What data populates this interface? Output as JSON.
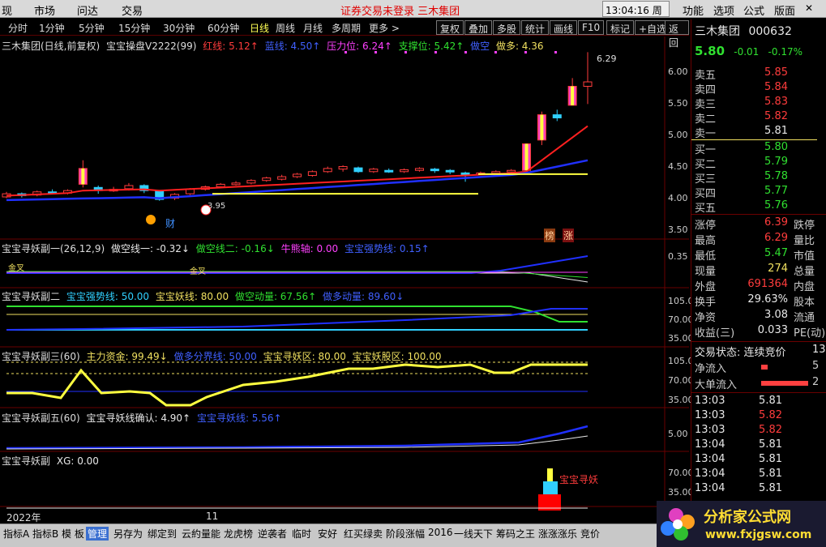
{
  "menu": {
    "left": [
      "现",
      "市场",
      "问达",
      "交易"
    ],
    "notice": "证券交易未登录  三木集团",
    "clock": "13:04:16 周三",
    "right": [
      "功能",
      "选项",
      "公式",
      "版面"
    ]
  },
  "periods": [
    "分时",
    "1分钟",
    "5分钟",
    "15分钟",
    "30分钟",
    "60分钟",
    "日线",
    "周线",
    "月线",
    "多周期",
    "更多 >"
  ],
  "active_period": "日线",
  "toolbar": [
    "复权",
    "叠加",
    "多股",
    "统计",
    "画线",
    "F10",
    "标记",
    "+自选",
    "返回"
  ],
  "main_panel": {
    "title": "三木集团(日线,前复权)",
    "indicator": "宝宝操盘V2222(99)",
    "labels": [
      {
        "text": "红线: 5.12↑",
        "color": "#ff3c3c"
      },
      {
        "text": "蓝线: 4.50↑",
        "color": "#4060ff"
      },
      {
        "text": "压力位: 6.24↑",
        "color": "#ff40ff"
      },
      {
        "text": "支撑位: 5.42↑",
        "color": "#30e030"
      },
      {
        "text": "做空",
        "color": "#4060ff"
      },
      {
        "text": "做多: 4.36",
        "color": "#f0e060"
      }
    ],
    "yticks": [
      "6.00",
      "5.50",
      "5.00",
      "4.50",
      "4.00",
      "3.50"
    ],
    "peak_label": "6.29",
    "low_label": "3.95",
    "marker_cai": "财",
    "marker_bang": "榜",
    "marker_zhang": "涨"
  },
  "sub1": {
    "name": "宝宝寻妖副一(26,12,9)",
    "labels": [
      {
        "text": "做空线一: -0.32↓",
        "color": "#e8e8e8"
      },
      {
        "text": "做空线二: -0.16↓",
        "color": "#30e030"
      },
      {
        "text": "牛熊轴: 0.00",
        "color": "#ff40ff"
      },
      {
        "text": "宝宝强势线: 0.15↑",
        "color": "#4060ff"
      }
    ],
    "ytick": "0.35",
    "tag1": "金叉",
    "tag2": "金叉"
  },
  "sub2": {
    "name": "宝宝寻妖副二",
    "labels": [
      {
        "text": "宝宝强势线: 50.00",
        "color": "#30d0ff"
      },
      {
        "text": "宝宝妖线: 80.00",
        "color": "#f0e060"
      },
      {
        "text": "做空动量: 67.56↑",
        "color": "#30e030"
      },
      {
        "text": "做多动量: 89.60↓",
        "color": "#4060ff"
      }
    ],
    "yticks": [
      "105.0",
      "70.00",
      "35.00"
    ]
  },
  "sub3": {
    "name": "宝宝寻妖副三(60)",
    "labels": [
      {
        "text": "主力资金: 99.49↓",
        "color": "#f0e060"
      },
      {
        "text": "做多分界线: 50.00",
        "color": "#4060ff"
      },
      {
        "text": "宝宝寻妖区: 80.00",
        "color": "#f0e060"
      },
      {
        "text": "宝宝妖股区: 100.00",
        "color": "#f0e060"
      }
    ],
    "yticks": [
      "105.0",
      "70.00",
      "35.00"
    ]
  },
  "sub4": {
    "name": "宝宝寻妖副五(60)",
    "labels": [
      {
        "text": "宝宝寻妖线确认: 4.90↑",
        "color": "#e8e8e8"
      },
      {
        "text": "宝宝寻妖线: 5.56↑",
        "color": "#4060ff"
      }
    ],
    "ytick": "5.00"
  },
  "sub5": {
    "name": "宝宝寻妖副",
    "labels": [
      {
        "text": "XG: 0.00",
        "color": "#e8e8e8"
      }
    ],
    "yticks": [
      "70.00",
      "35.00"
    ],
    "signal": "宝宝寻妖"
  },
  "xaxis": {
    "year": "2022年",
    "month": "11"
  },
  "quote": {
    "name": "三木集团",
    "code": "000632",
    "price": "5.80",
    "change": "-0.01",
    "pct": "-0.17%",
    "asks": [
      {
        "label": "卖五",
        "price": "5.85"
      },
      {
        "label": "卖四",
        "price": "5.84"
      },
      {
        "label": "卖三",
        "price": "5.83"
      },
      {
        "label": "卖二",
        "price": "5.82"
      },
      {
        "label": "卖一",
        "price": "5.81"
      }
    ],
    "bids": [
      {
        "label": "买一",
        "price": "5.80"
      },
      {
        "label": "买二",
        "price": "5.79"
      },
      {
        "label": "买三",
        "price": "5.78"
      },
      {
        "label": "买四",
        "price": "5.77"
      },
      {
        "label": "买五",
        "price": "5.76"
      }
    ],
    "stats": [
      {
        "a": "涨停",
        "v": "6.39",
        "c": "red",
        "b": "跌停"
      },
      {
        "a": "最高",
        "v": "6.29",
        "c": "red",
        "b": "量比"
      },
      {
        "a": "最低",
        "v": "5.47",
        "c": "grn",
        "b": "市值"
      },
      {
        "a": "现量",
        "v": "274",
        "c": "yel",
        "b": "总量"
      },
      {
        "a": "外盘",
        "v": "691364",
        "c": "red",
        "b": "内盘"
      },
      {
        "a": "换手",
        "v": "29.63%",
        "c": "wht",
        "b": "股本"
      },
      {
        "a": "净资",
        "v": "3.08",
        "c": "wht",
        "b": "流通"
      },
      {
        "a": "收益(三)",
        "v": "0.033",
        "c": "wht",
        "b": "PE(动)"
      }
    ],
    "trade_state_label": "交易状态: 连续竞价",
    "trade_state_suffix": "13",
    "net_inflow": "净流入",
    "net_inflow_val": "5",
    "big_order": "大单流入",
    "big_order_val": "2",
    "ticks": [
      {
        "t": "13:03",
        "p": "5.81",
        "c": "wht"
      },
      {
        "t": "13:03",
        "p": "5.82",
        "c": "red"
      },
      {
        "t": "13:03",
        "p": "5.82",
        "c": "red"
      },
      {
        "t": "13:04",
        "p": "5.81",
        "c": "wht"
      },
      {
        "t": "13:04",
        "p": "5.81",
        "c": "wht"
      },
      {
        "t": "13:04",
        "p": "5.81",
        "c": "wht"
      },
      {
        "t": "13:04",
        "p": "5.81",
        "c": "wht"
      }
    ]
  },
  "bottom_tabs": [
    "指标A",
    "指标B",
    "模 板",
    "管理",
    "另存为",
    "绑定到",
    "云約量能",
    "龙虎榜",
    "逆袭者",
    "临时",
    "安好",
    "红买绿卖",
    "阶段涨幅",
    "2016",
    "一线天下",
    "筹码之王",
    "涨涨涨乐",
    "竞价"
  ],
  "active_tab": "管理",
  "logo": {
    "title": "分析家公式网",
    "url": "www.fxjgsw.com"
  },
  "watermark": "分析家公式网 www.fxjgsw.com",
  "chart_data": {
    "type": "line",
    "title": "三木集团(日线,前复权)",
    "yticks": [
      3.5,
      4.0,
      4.5,
      5.0,
      5.5,
      6.0
    ],
    "candles": [
      {
        "o": 4.0,
        "c": 4.05,
        "h": 4.08,
        "l": 3.98
      },
      {
        "o": 4.05,
        "c": 4.02,
        "h": 4.07,
        "l": 3.99
      },
      {
        "o": 4.03,
        "c": 4.08,
        "h": 4.1,
        "l": 4.01
      },
      {
        "o": 4.08,
        "c": 4.06,
        "h": 4.12,
        "l": 4.04
      },
      {
        "o": 4.06,
        "c": 4.1,
        "h": 4.12,
        "l": 4.04
      },
      {
        "o": 4.2,
        "c": 4.45,
        "h": 4.58,
        "l": 4.15
      },
      {
        "o": 4.15,
        "c": 4.1,
        "h": 4.18,
        "l": 4.05
      },
      {
        "o": 4.1,
        "c": 4.12,
        "h": 4.16,
        "l": 4.08
      },
      {
        "o": 4.13,
        "c": 4.18,
        "h": 4.22,
        "l": 4.1
      },
      {
        "o": 4.18,
        "c": 4.1,
        "h": 4.2,
        "l": 4.06
      },
      {
        "o": 4.1,
        "c": 3.96,
        "h": 4.1,
        "l": 3.94
      },
      {
        "o": 3.98,
        "c": 4.04,
        "h": 4.06,
        "l": 3.95
      },
      {
        "o": 4.05,
        "c": 4.12,
        "h": 4.14,
        "l": 4.03
      },
      {
        "o": 4.12,
        "c": 4.16,
        "h": 4.18,
        "l": 4.1
      },
      {
        "o": 4.16,
        "c": 4.2,
        "h": 4.22,
        "l": 4.14
      },
      {
        "o": 4.2,
        "c": 4.22,
        "h": 4.25,
        "l": 4.18
      },
      {
        "o": 4.22,
        "c": 4.26,
        "h": 4.28,
        "l": 4.2
      },
      {
        "o": 4.26,
        "c": 4.3,
        "h": 4.32,
        "l": 4.24
      },
      {
        "o": 4.28,
        "c": 4.32,
        "h": 4.35,
        "l": 4.26
      },
      {
        "o": 4.32,
        "c": 4.36,
        "h": 4.38,
        "l": 4.3
      },
      {
        "o": 4.34,
        "c": 4.4,
        "h": 4.42,
        "l": 4.32
      },
      {
        "o": 4.4,
        "c": 4.45,
        "h": 4.48,
        "l": 4.38
      },
      {
        "o": 4.44,
        "c": 4.48,
        "h": 4.5,
        "l": 4.4
      },
      {
        "o": 4.46,
        "c": 4.4,
        "h": 4.48,
        "l": 4.38
      },
      {
        "o": 4.4,
        "c": 4.44,
        "h": 4.46,
        "l": 4.38
      },
      {
        "o": 4.42,
        "c": 4.4,
        "h": 4.45,
        "l": 4.38
      },
      {
        "o": 4.4,
        "c": 4.43,
        "h": 4.45,
        "l": 4.38
      },
      {
        "o": 4.42,
        "c": 4.45,
        "h": 4.47,
        "l": 4.4
      },
      {
        "o": 4.44,
        "c": 4.42,
        "h": 4.46,
        "l": 4.38
      },
      {
        "o": 4.42,
        "c": 4.4,
        "h": 4.44,
        "l": 4.36
      },
      {
        "o": 4.38,
        "c": 4.36,
        "h": 4.4,
        "l": 4.24
      },
      {
        "o": 4.36,
        "c": 4.38,
        "h": 4.4,
        "l": 4.34
      },
      {
        "o": 4.38,
        "c": 4.4,
        "h": 4.42,
        "l": 4.36
      },
      {
        "o": 4.4,
        "c": 4.42,
        "h": 4.44,
        "l": 4.38
      },
      {
        "o": 4.42,
        "c": 4.84,
        "h": 4.84,
        "l": 4.42
      },
      {
        "o": 4.9,
        "c": 5.3,
        "h": 5.35,
        "l": 4.82
      },
      {
        "o": 5.3,
        "c": 5.25,
        "h": 5.38,
        "l": 5.2
      },
      {
        "o": 5.45,
        "c": 5.75,
        "h": 5.88,
        "l": 5.45
      },
      {
        "o": 5.75,
        "c": 5.82,
        "h": 6.29,
        "l": 5.47
      }
    ]
  }
}
